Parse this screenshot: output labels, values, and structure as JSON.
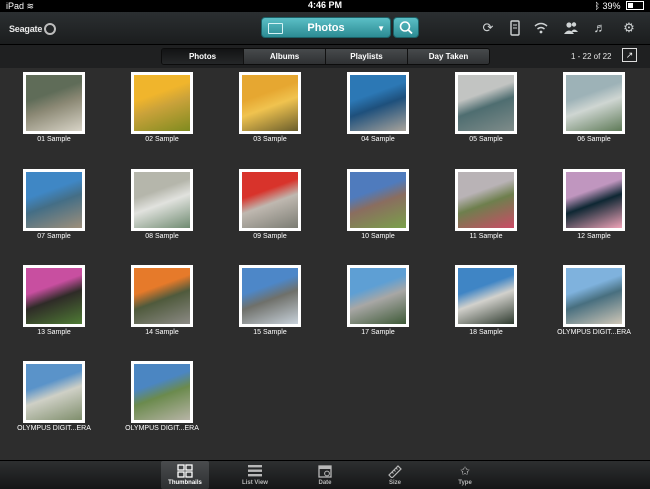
{
  "statusbar": {
    "device": "iPad",
    "time": "4:46 PM",
    "battery": "39%",
    "battery_level": 0.39
  },
  "toolbar": {
    "brand": "Seagate",
    "picker_label": "Photos",
    "icons": [
      "sync-icon",
      "drive-icon",
      "wifi-icon",
      "people-icon",
      "music-icon",
      "gear-icon"
    ]
  },
  "segments": [
    {
      "label": "Photos",
      "active": true
    },
    {
      "label": "Albums",
      "active": false
    },
    {
      "label": "Playlists",
      "active": false
    },
    {
      "label": "Day Taken",
      "active": false
    }
  ],
  "count_text": "1 - 22 of 22",
  "photos": [
    {
      "caption": "01 Sample",
      "colors": [
        "#5f6c58",
        "#d8d4c7",
        "#8b8874"
      ]
    },
    {
      "caption": "02 Sample",
      "colors": [
        "#f0b52c",
        "#7f8b1f",
        "#caa23a"
      ]
    },
    {
      "caption": "03 Sample",
      "colors": [
        "#e6a731",
        "#6a5e2c",
        "#f0c34f"
      ]
    },
    {
      "caption": "04 Sample",
      "colors": [
        "#2c78b5",
        "#a9a49b",
        "#1e507c"
      ]
    },
    {
      "caption": "05 Sample",
      "colors": [
        "#c2c4c2",
        "#7f8c8a",
        "#4e6d70"
      ]
    },
    {
      "caption": "06 Sample",
      "colors": [
        "#9db2b7",
        "#5e7a57",
        "#cfd6d2"
      ]
    },
    {
      "caption": "07 Sample",
      "colors": [
        "#3f87c5",
        "#9e8f7b",
        "#446e86"
      ]
    },
    {
      "caption": "08 Sample",
      "colors": [
        "#b5b6ab",
        "#6f8b71",
        "#e1e2de"
      ]
    },
    {
      "caption": "09 Sample",
      "colors": [
        "#d8332b",
        "#7b7c73",
        "#bfb8b0"
      ]
    },
    {
      "caption": "10 Sample",
      "colors": [
        "#4f7bbd",
        "#7aa04a",
        "#8a6d5f"
      ]
    },
    {
      "caption": "11 Sample",
      "colors": [
        "#b9b3b6",
        "#cc4b66",
        "#6e7f4d"
      ]
    },
    {
      "caption": "12 Sample",
      "colors": [
        "#c096bf",
        "#f0a3b8",
        "#0e2733"
      ]
    },
    {
      "caption": "13 Sample",
      "colors": [
        "#c84fa0",
        "#4f7c35",
        "#2e2b27"
      ]
    },
    {
      "caption": "14 Sample",
      "colors": [
        "#e67a2a",
        "#8c8a85",
        "#4f5a3c"
      ]
    },
    {
      "caption": "15 Sample",
      "colors": [
        "#4d87c8",
        "#c8d2db",
        "#6f706a"
      ]
    },
    {
      "caption": "17 Sample",
      "colors": [
        "#5e9fd4",
        "#3e5a37",
        "#a8a7a5"
      ]
    },
    {
      "caption": "18 Sample",
      "colors": [
        "#3f85c5",
        "#2e3a2e",
        "#d2d1cc"
      ]
    },
    {
      "caption": "OLYMPUS DIGIT...ERA",
      "colors": [
        "#7fb2dd",
        "#cfc7b7",
        "#486f7f"
      ]
    },
    {
      "caption": "OLYMPUS DIGIT...ERA",
      "colors": [
        "#5a93c9",
        "#7f8e6c",
        "#cfd0c6"
      ]
    },
    {
      "caption": "OLYMPUS DIGIT...ERA",
      "colors": [
        "#4b86c2",
        "#b7b4a6",
        "#6b8a4d"
      ]
    }
  ],
  "bottom_tabs": [
    {
      "label": "Thumbnails",
      "icon": "grid-icon",
      "active": true
    },
    {
      "label": "List View",
      "icon": "list-icon",
      "active": false
    },
    {
      "label": "Date",
      "icon": "calendar-icon",
      "active": false
    },
    {
      "label": "Size",
      "icon": "ruler-icon",
      "active": false
    },
    {
      "label": "Type",
      "icon": "star-icon",
      "active": false
    }
  ]
}
